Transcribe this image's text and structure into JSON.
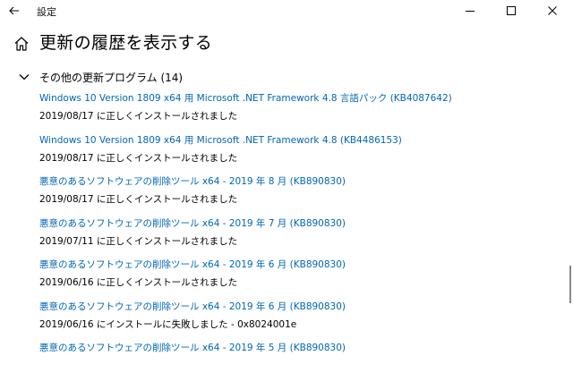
{
  "window": {
    "title": "設定",
    "controls": {
      "minimize": "minimize-icon",
      "maximize": "maximize-icon",
      "close": "close-icon"
    }
  },
  "header": {
    "title": "更新の履歴を表示する"
  },
  "section": {
    "label": "その他の更新プログラム (14)",
    "expanded": true
  },
  "updates": [
    {
      "name": "Windows 10 Version 1809 x64 用 Microsoft .NET Framework 4.8 言語パック (KB4087642)",
      "status": "2019/08/17 に正しくインストールされました"
    },
    {
      "name": "Windows 10 Version 1809 x64 用 Microsoft .NET Framework 4.8 (KB4486153)",
      "status": "2019/08/17 に正しくインストールされました"
    },
    {
      "name": "悪意のあるソフトウェアの削除ツール x64 - 2019 年 8 月 (KB890830)",
      "status": "2019/08/17 に正しくインストールされました"
    },
    {
      "name": "悪意のあるソフトウェアの削除ツール x64 - 2019 年 7 月 (KB890830)",
      "status": "2019/07/11 に正しくインストールされました"
    },
    {
      "name": "悪意のあるソフトウェアの削除ツール x64 - 2019 年 6 月 (KB890830)",
      "status": "2019/06/16 に正しくインストールされました"
    },
    {
      "name": "悪意のあるソフトウェアの削除ツール x64 - 2019 年 6 月 (KB890830)",
      "status": "2019/06/16 にインストールに失敗しました - 0x8024001e"
    },
    {
      "name": "悪意のあるソフトウェアの削除ツール x64 - 2019 年 5 月 (KB890830)",
      "status": ""
    }
  ],
  "colors": {
    "link": "#0066b4",
    "text": "#000000",
    "background": "#ffffff"
  }
}
